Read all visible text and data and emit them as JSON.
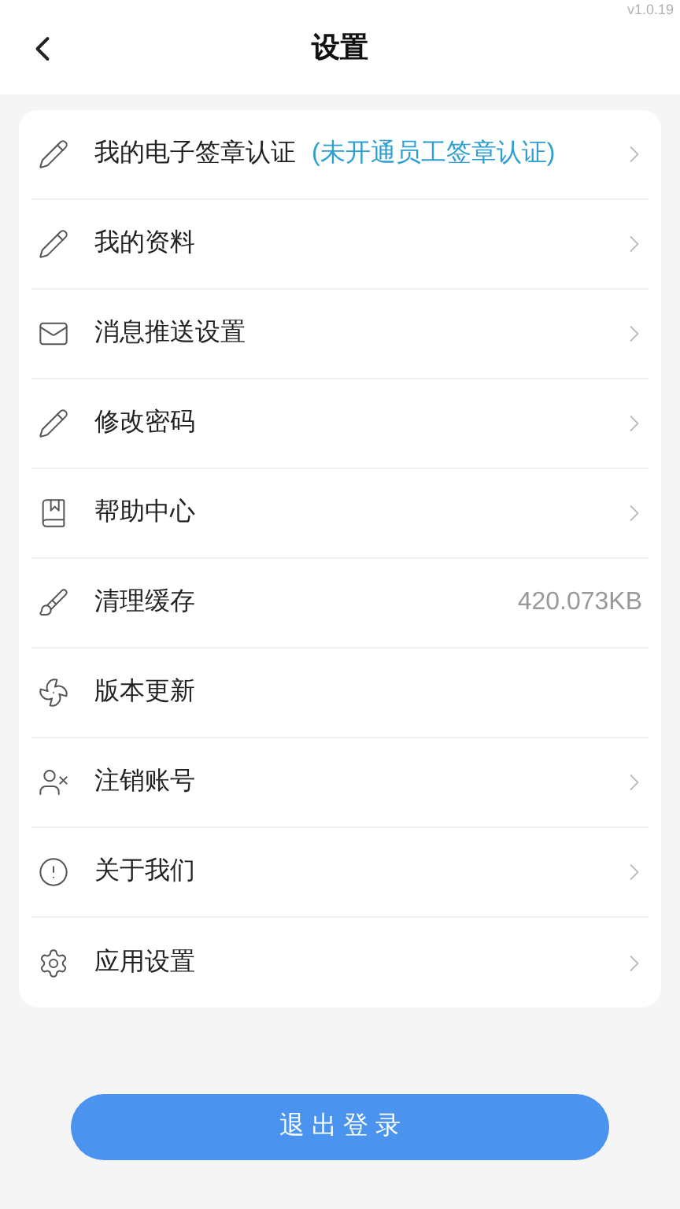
{
  "version": "v1.0.19",
  "header": {
    "title": "设置"
  },
  "items": [
    {
      "label": "我的电子签章认证",
      "note": "(未开通员工签章认证)",
      "chevron": true
    },
    {
      "label": "我的资料",
      "chevron": true
    },
    {
      "label": "消息推送设置",
      "chevron": true
    },
    {
      "label": "修改密码",
      "chevron": true
    },
    {
      "label": "帮助中心",
      "chevron": true
    },
    {
      "label": "清理缓存",
      "value": "420.073KB",
      "chevron": false
    },
    {
      "label": "版本更新",
      "chevron": false
    },
    {
      "label": "注销账号",
      "chevron": true
    },
    {
      "label": "关于我们",
      "chevron": true
    },
    {
      "label": "应用设置",
      "chevron": true
    }
  ],
  "logout_button": "退 出 登 录"
}
